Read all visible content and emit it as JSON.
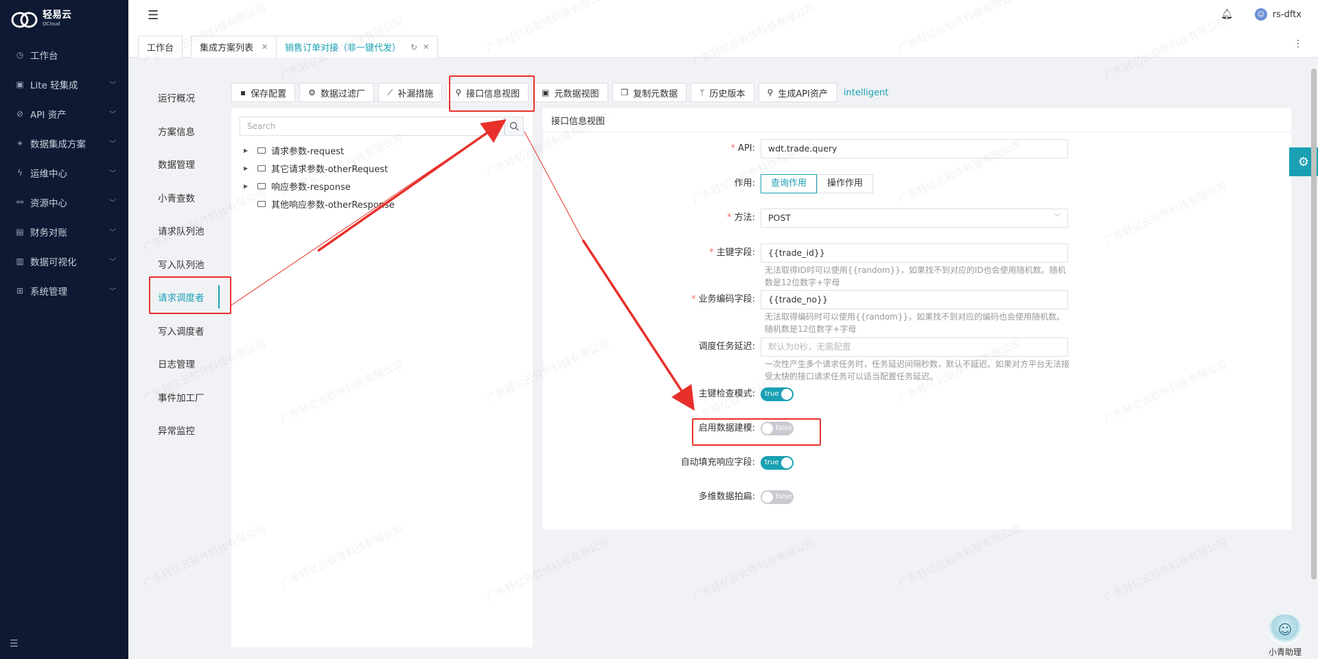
{
  "brand": {
    "name": "轻易云",
    "sub": "QCloud"
  },
  "sidebar": {
    "items": [
      {
        "label": "工作台",
        "icon": "clock-icon",
        "glyph": "◷",
        "chevron": false
      },
      {
        "label": "Lite 轻集成",
        "icon": "lite-icon",
        "glyph": "▣",
        "chevron": true
      },
      {
        "label": "API 资产",
        "icon": "compass-icon",
        "glyph": "⊘",
        "chevron": true
      },
      {
        "label": "数据集成方案",
        "icon": "cluster-icon",
        "glyph": "⚹",
        "chevron": true
      },
      {
        "label": "运维中心",
        "icon": "bolt-icon",
        "glyph": "ϟ",
        "chevron": true
      },
      {
        "label": "资源中心",
        "icon": "nodes-icon",
        "glyph": "⚯",
        "chevron": true
      },
      {
        "label": "财务对账",
        "icon": "calculator-icon",
        "glyph": "▤",
        "chevron": true
      },
      {
        "label": "数据可视化",
        "icon": "bar-chart-icon",
        "glyph": "▥",
        "chevron": true
      },
      {
        "label": "系统管理",
        "icon": "grid-icon",
        "glyph": "⊞",
        "chevron": true
      }
    ]
  },
  "header": {
    "username": "rs-dftx"
  },
  "tabs": [
    {
      "label": "工作台"
    },
    {
      "label": "集成方案列表"
    },
    {
      "label": "销售订单对接（非一键代发）"
    }
  ],
  "submenu": [
    "运行概况",
    "方案信息",
    "数据管理",
    "小青查数",
    "请求队列池",
    "写入队列池",
    "请求调度者",
    "写入调度者",
    "日志管理",
    "事件加工厂",
    "异常监控"
  ],
  "toolbar": [
    {
      "label": "保存配置",
      "icon": "save-icon",
      "glyph": "▪"
    },
    {
      "label": "数据过滤厂",
      "icon": "gear-icon",
      "glyph": "⚙"
    },
    {
      "label": "补漏措施",
      "icon": "chart-line-icon",
      "glyph": "⟋"
    },
    {
      "label": "接口信息视图",
      "icon": "link-icon",
      "glyph": "⚲"
    },
    {
      "label": "元数据视图",
      "icon": "terminal-icon",
      "glyph": "▣"
    },
    {
      "label": "复制元数据",
      "icon": "copy-icon",
      "glyph": "❐"
    },
    {
      "label": "历史版本",
      "icon": "branch-icon",
      "glyph": "ᛘ"
    },
    {
      "label": "生成API资产",
      "icon": "link-icon",
      "glyph": "⚲"
    }
  ],
  "toolbar_extra": "intelligent",
  "tree": {
    "search_placeholder": "Search",
    "nodes": [
      {
        "label": "请求参数-request",
        "expandable": true
      },
      {
        "label": "其它请求参数-otherRequest",
        "expandable": true
      },
      {
        "label": "响应参数-response",
        "expandable": true
      },
      {
        "label": "其他响应参数-otherResponse",
        "expandable": false
      }
    ]
  },
  "form": {
    "title": "接口信息视图",
    "api": {
      "label": "API:",
      "value": "wdt.trade.query"
    },
    "purpose": {
      "label": "作用:",
      "options": [
        "查询作用",
        "操作作用"
      ],
      "selected": "查询作用"
    },
    "method": {
      "label": "方法:",
      "value": "POST"
    },
    "pk": {
      "label": "主键字段:",
      "value": "{{trade_id}}",
      "hint": "无法取得ID时可以使用{{random}}，如果找不到对应的ID也会使用随机数。随机数是12位数字+字母"
    },
    "bizcode": {
      "label": "业务编码字段:",
      "value": "{{trade_no}}",
      "hint": "无法取得编码时可以使用{{random}}，如果找不到对应的编码也会使用随机数。随机数是12位数字+字母"
    },
    "delay": {
      "label": "调度任务延迟:",
      "placeholder": "默认为0秒，无需配置",
      "hint": "一次性产生多个请求任务时，任务延迟间隔秒数，默认不延迟。如果对方平台无法接受太快的接口请求任务可以适当配置任务延迟。"
    },
    "pkcheck": {
      "label": "主键检查模式:",
      "value": "true"
    },
    "modeling": {
      "label": "启用数据建模:",
      "value": "false"
    },
    "autofill": {
      "label": "自动填充响应字段:",
      "value": "true"
    },
    "flatten": {
      "label": "多维数据拍扁:",
      "value": "false"
    }
  },
  "assistant": {
    "label": "小青助理"
  },
  "watermark": "广东轻亿云软件科技有限公司",
  "colors": {
    "accent": "#1aa0b3",
    "sidebar_bg": "#0e1a33",
    "annotation_red": "#e8302a"
  }
}
